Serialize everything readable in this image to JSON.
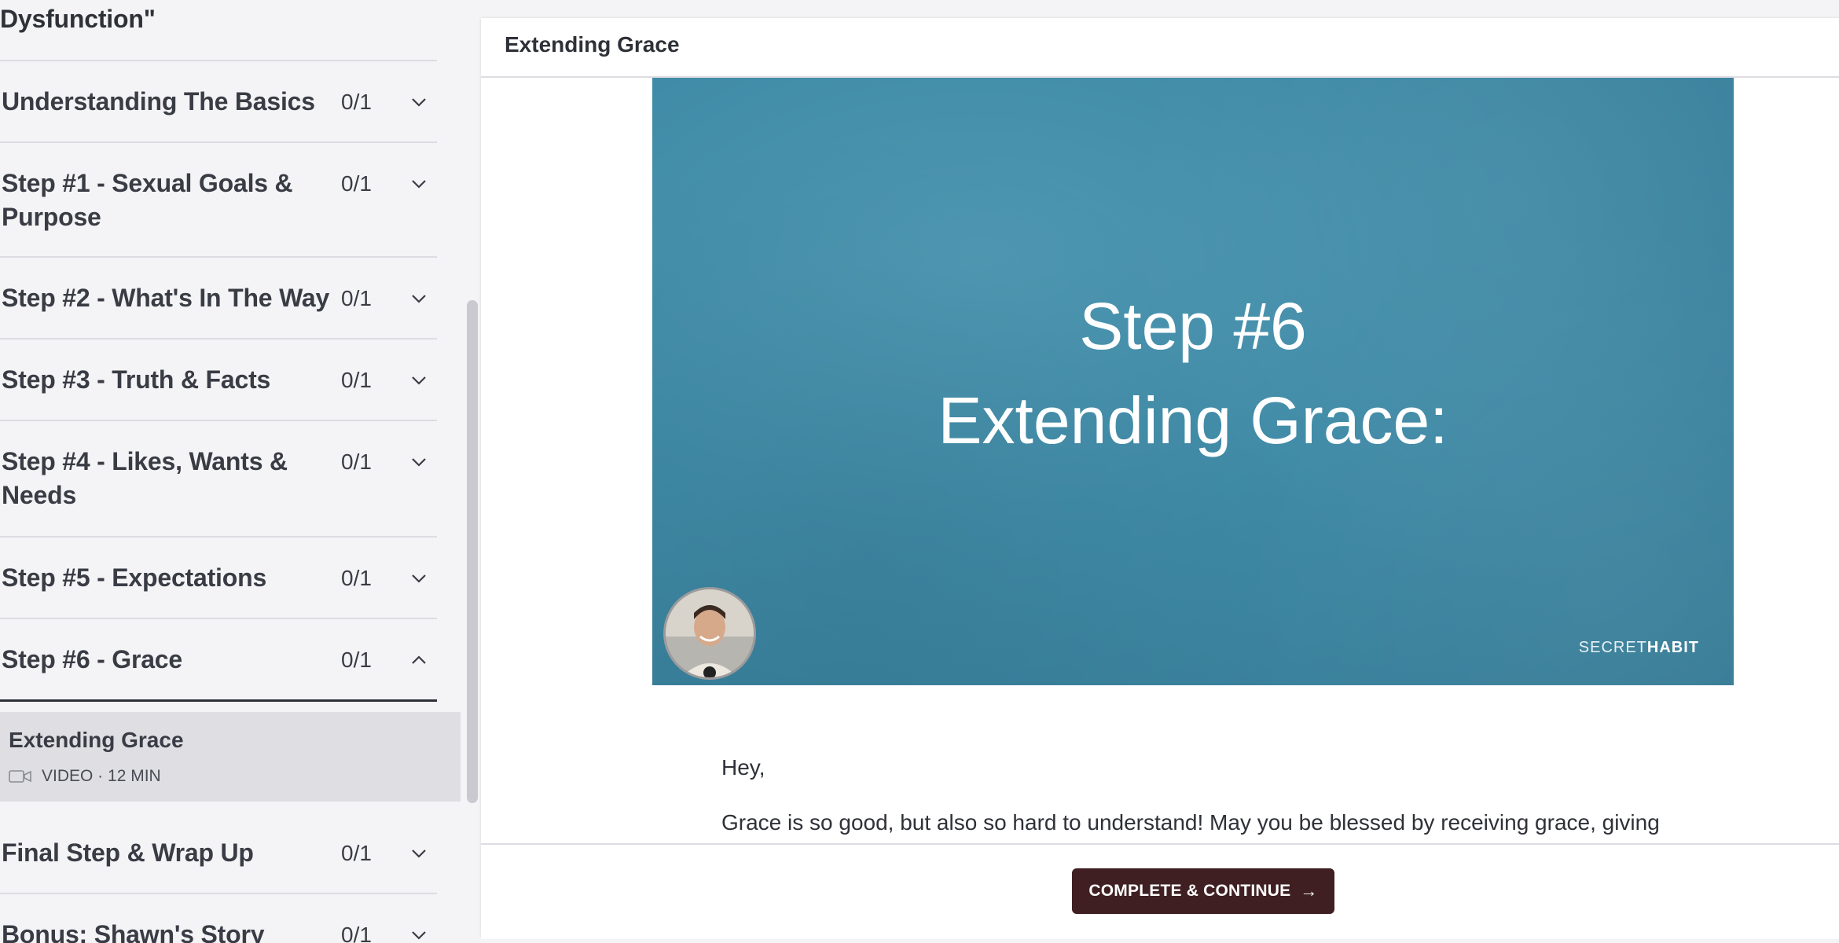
{
  "sidebar": {
    "truncated_title": "Dysfunction\"",
    "sections": [
      {
        "title": "Understanding The Basics",
        "count": "0/1",
        "expanded": false
      },
      {
        "title": "Step #1 - Sexual Goals & Purpose",
        "count": "0/1",
        "expanded": false
      },
      {
        "title": "Step #2 - What's In The Way",
        "count": "0/1",
        "expanded": false
      },
      {
        "title": "Step #3 - Truth & Facts",
        "count": "0/1",
        "expanded": false
      },
      {
        "title": "Step #4 - Likes, Wants & Needs",
        "count": "0/1",
        "expanded": false
      },
      {
        "title": "Step #5 - Expectations",
        "count": "0/1",
        "expanded": false
      },
      {
        "title": "Step #6 - Grace",
        "count": "0/1",
        "expanded": true
      },
      {
        "title": "Final Step & Wrap Up",
        "count": "0/1",
        "expanded": false
      },
      {
        "title": "Bonus: Shawn's Story",
        "count": "0/1",
        "expanded": false
      }
    ],
    "active_lesson": {
      "title": "Extending Grace",
      "meta": "VIDEO · 12 MIN",
      "icon": "video-camera-icon"
    }
  },
  "main": {
    "header_title": "Extending Grace",
    "video": {
      "line1": "Step #6",
      "line2": "Extending Grace:",
      "brand_prefix": "SECRET",
      "brand_suffix": "HABIT",
      "background": "#4590ad"
    },
    "body": {
      "greeting": "Hey,",
      "paragraph": "Grace is so good, but also so hard to understand! May you be blessed by receiving grace, giving"
    },
    "cta": {
      "label": "COMPLETE & CONTINUE",
      "arrow": "→",
      "color": "#3f1f22"
    }
  }
}
